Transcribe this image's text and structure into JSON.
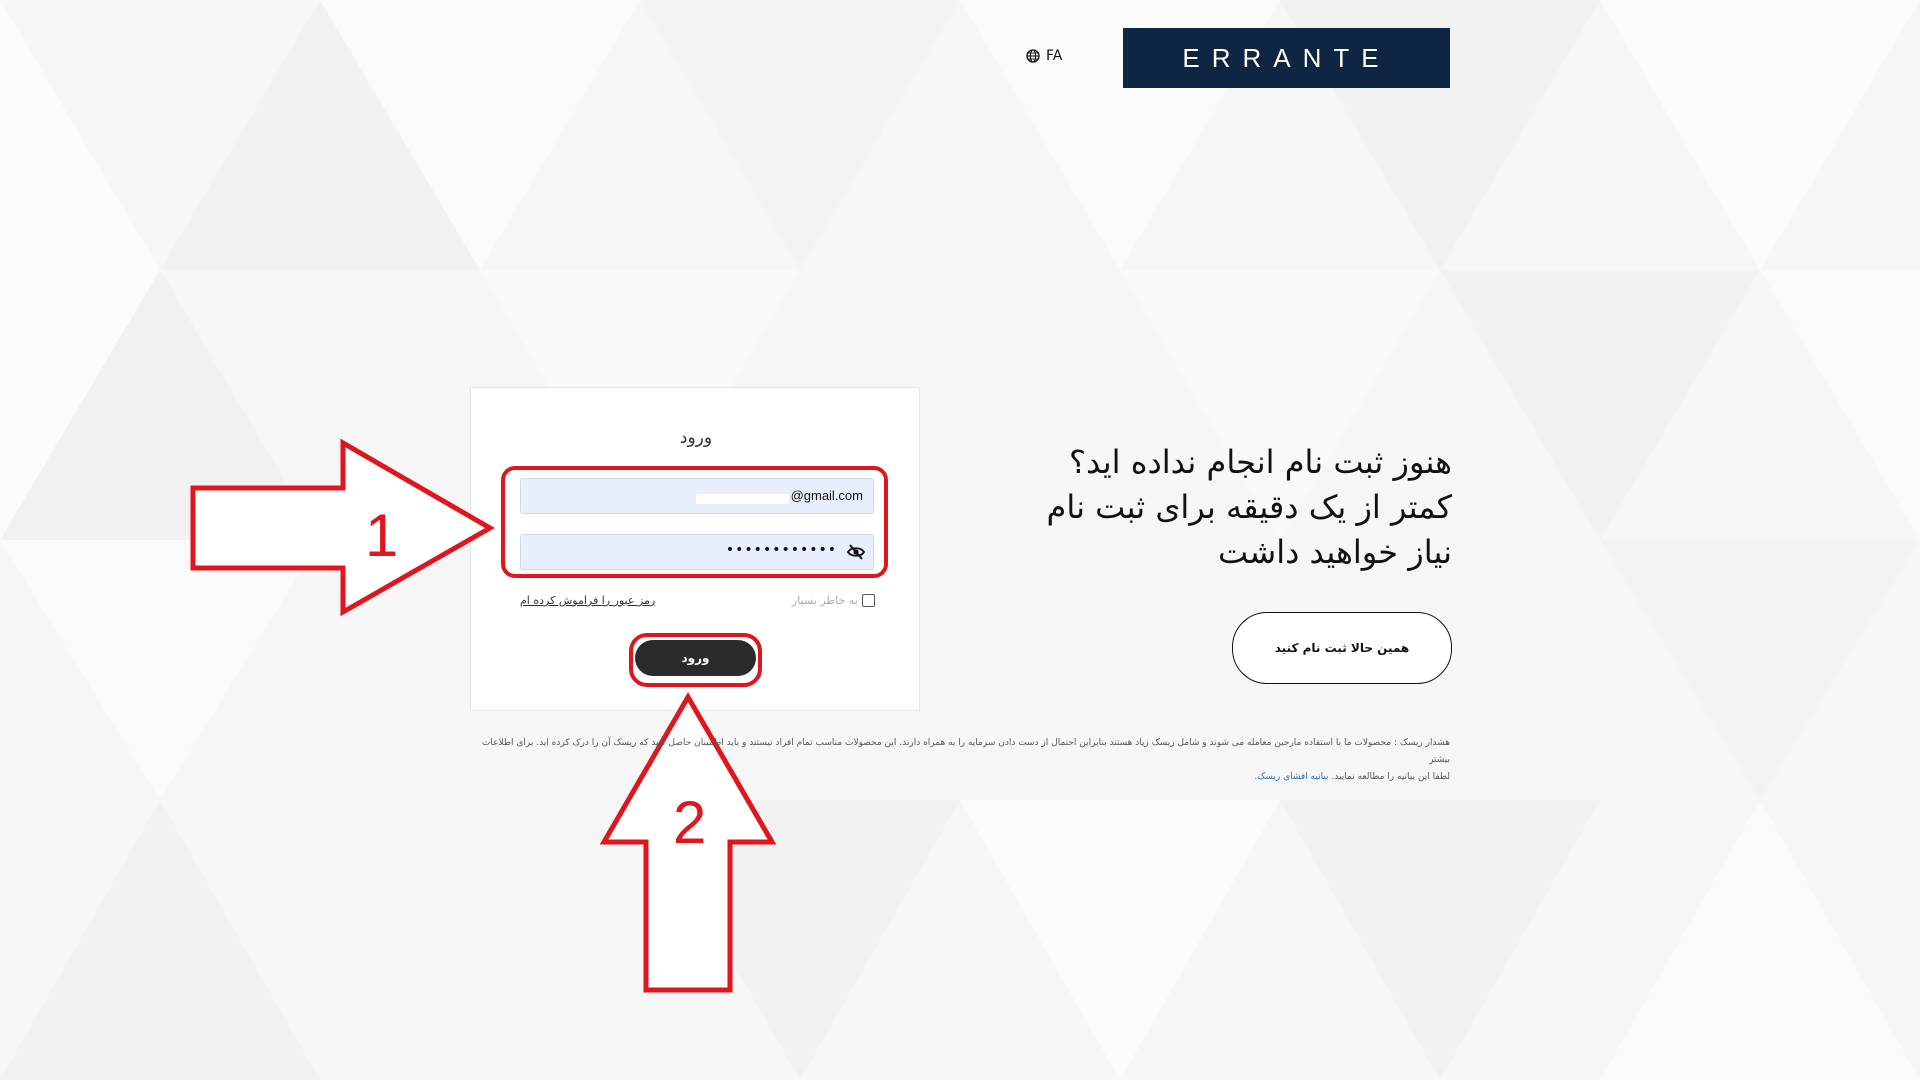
{
  "header": {
    "language": "FA",
    "logo_text": "ERRANTE"
  },
  "login": {
    "title": "ورود",
    "email_suffix": "@gmail.com",
    "password_masked": "••••••••••••",
    "remember_label": "به خاطر بسپار",
    "forgot_label": "رمز عبور را فراموش کرده ام",
    "submit_label": "ورود"
  },
  "promo": {
    "line1": "هنوز ثبت نام انجام نداده اید؟",
    "line2": "کمتر از یک دقیقه برای ثبت نام",
    "line3": "نیاز خواهید داشت",
    "signup_label": "همین حالا ثبت نام کنید"
  },
  "risk": {
    "line1": "هشدار ریسک : محصولات ما با استفاده مارجین معامله می شوند و شامل ریسک زیاد هستند بنابراین احتمال از دست دادن سرمایه را به همراه دارند. این محصولات مناسب تمام افراد نیستند و باید اطمینان حاصل کنید که ریسک آن را درک کرده اید. برای اطلاعات بیشتر",
    "line2_prefix": "لطفا این بیانیه را مطالعه نمایید.",
    "link_label": "بیانیه افشای ریسک."
  },
  "annotations": {
    "step1": "1",
    "step2": "2",
    "color": "#e0161e"
  },
  "colors": {
    "brand_navy": "#0f2544",
    "brand_red": "#d6242b",
    "button_dark": "#2b2b2b",
    "input_fill": "#e8effc"
  }
}
